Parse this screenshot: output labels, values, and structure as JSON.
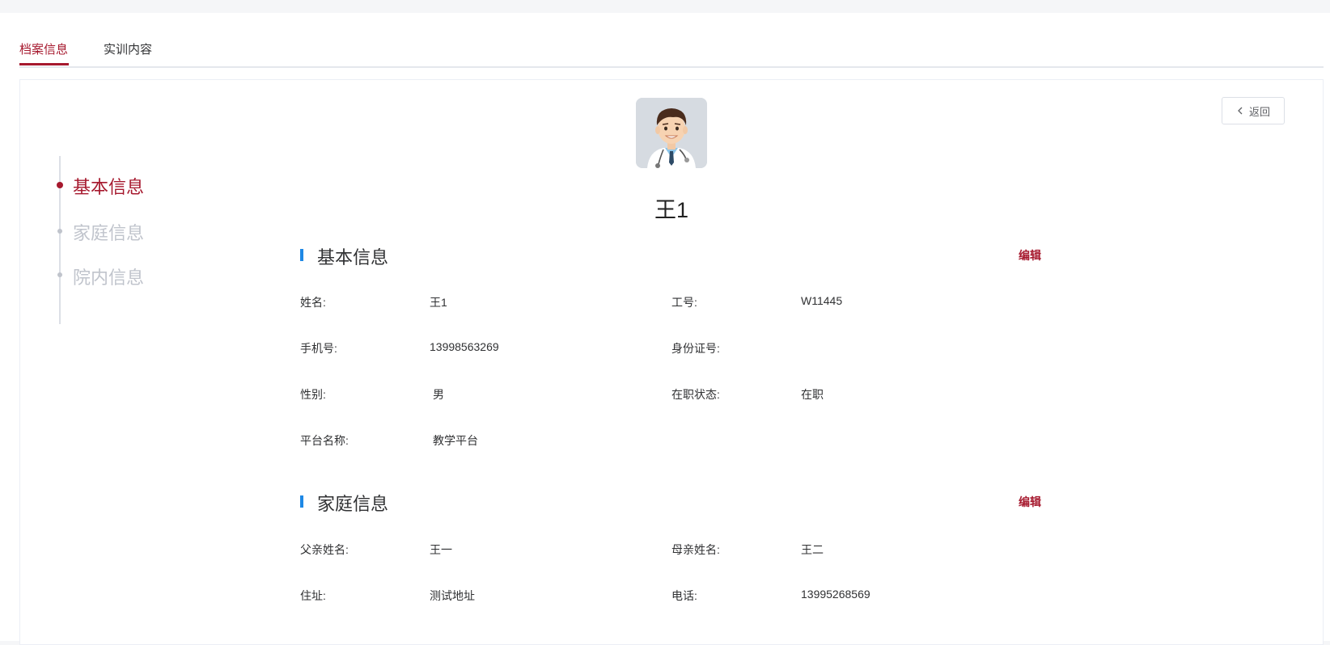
{
  "tabs": [
    {
      "label": "档案信息",
      "active": true
    },
    {
      "label": "实训内容",
      "active": false
    }
  ],
  "back_button": {
    "label": "返回",
    "icon": "chevron-left-icon"
  },
  "anchor_nav": [
    {
      "label": "基本信息",
      "active": true
    },
    {
      "label": "家庭信息",
      "active": false
    },
    {
      "label": "院内信息",
      "active": false
    }
  ],
  "profile": {
    "name": "王1",
    "avatar": "doctor-avatar"
  },
  "basic_info": {
    "title": "基本信息",
    "edit_label": "编辑",
    "fields": {
      "name_label": "姓名:",
      "name_value": "王1",
      "job_no_label": "工号:",
      "job_no_value": "W11445",
      "phone_label": "手机号:",
      "phone_value": "13998563269",
      "id_label": "身份证号:",
      "id_value": "",
      "gender_label": "性别:",
      "gender_value": "男",
      "status_label": "在职状态:",
      "status_value": "在职",
      "platform_label": "平台名称:",
      "platform_value": "教学平台"
    }
  },
  "family_info": {
    "title": "家庭信息",
    "edit_label": "编辑",
    "fields": {
      "father_label": "父亲姓名:",
      "father_value": "王一",
      "mother_label": "母亲姓名:",
      "mother_value": "王二",
      "address_label": "住址:",
      "address_value": "测试地址",
      "tel_label": "电话:",
      "tel_value": "13995268569"
    }
  },
  "colors": {
    "accent": "#a6192e",
    "section_bar": "#1e88e5",
    "muted": "#c0c4cc"
  }
}
